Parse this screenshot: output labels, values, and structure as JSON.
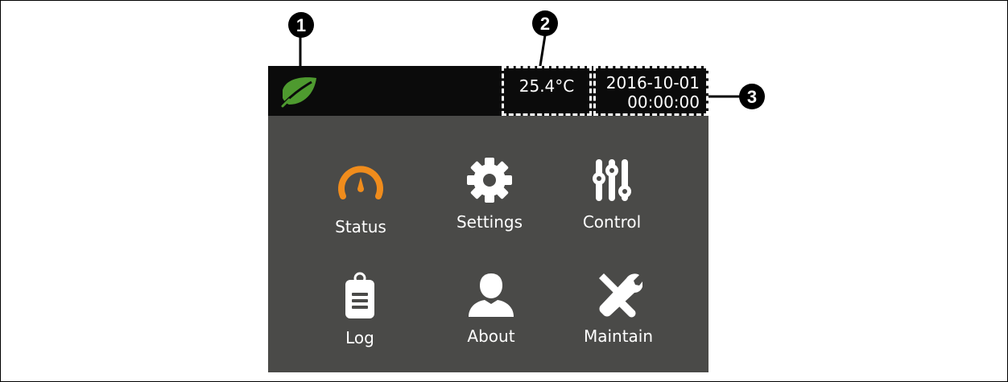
{
  "callouts": [
    {
      "number": "1",
      "target": "logo"
    },
    {
      "number": "2",
      "target": "temperature"
    },
    {
      "number": "3",
      "target": "date-time"
    }
  ],
  "header": {
    "logo_icon": "leaf-icon",
    "logo_color": "#4e9a2f",
    "temperature": "25.4°C",
    "date": "2016-10-01",
    "time": "00:00:00"
  },
  "menu": {
    "items": [
      {
        "label": "Status",
        "icon": "gauge-icon",
        "color": "#f08c1c"
      },
      {
        "label": "Settings",
        "icon": "gear-icon",
        "color": "#ffffff"
      },
      {
        "label": "Control",
        "icon": "sliders-icon",
        "color": "#ffffff"
      },
      {
        "label": "Log",
        "icon": "clipboard-icon",
        "color": "#ffffff"
      },
      {
        "label": "About",
        "icon": "user-icon",
        "color": "#ffffff"
      },
      {
        "label": "Maintain",
        "icon": "tools-icon",
        "color": "#ffffff"
      }
    ]
  },
  "colors": {
    "screen_background": "#4a4a48",
    "topbar_background": "#0b0b0b",
    "accent": "#f08c1c"
  }
}
